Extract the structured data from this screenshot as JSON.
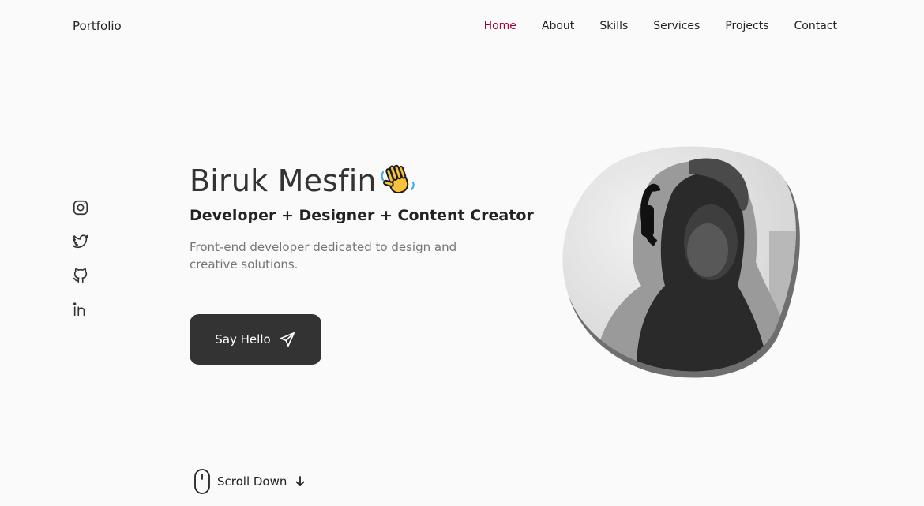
{
  "header": {
    "logo": "Portfolio",
    "nav": [
      {
        "label": "Home",
        "active": true
      },
      {
        "label": "About",
        "active": false
      },
      {
        "label": "Skills",
        "active": false
      },
      {
        "label": "Services",
        "active": false
      },
      {
        "label": "Projects",
        "active": false
      },
      {
        "label": "Contact",
        "active": false
      }
    ]
  },
  "social": [
    {
      "icon": "instagram-icon"
    },
    {
      "icon": "twitter-icon"
    },
    {
      "icon": "github-icon"
    },
    {
      "icon": "linkedin-icon"
    }
  ],
  "hero": {
    "name": "Biruk Mesfin",
    "subtitle": "Developer + Designer + Content Creator",
    "description": "Front-end developer dedicated to design and creative solutions.",
    "button_label": "Say Hello",
    "button_icon": "send-icon"
  },
  "scroll": {
    "label": "Scroll Down"
  },
  "colors": {
    "background": "#fafafa",
    "accent": "#a3003b",
    "button_bg": "#333333",
    "text": "#333333"
  }
}
